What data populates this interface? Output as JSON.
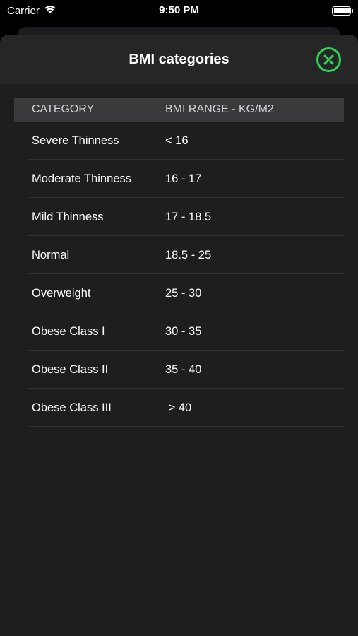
{
  "status_bar": {
    "carrier": "Carrier",
    "time": "9:50 PM",
    "icons": [
      "wifi-icon",
      "battery-icon"
    ]
  },
  "sheet": {
    "title": "BMI categories",
    "close_icon": "close-circle-icon",
    "accent_color": "#30d158"
  },
  "table": {
    "headers": [
      "CATEGORY",
      "BMI RANGE - KG/M2"
    ],
    "rows": [
      {
        "category": "Severe Thinness",
        "range": "< 16"
      },
      {
        "category": "Moderate Thinness",
        "range": "16 - 17"
      },
      {
        "category": "Mild Thinness",
        "range": "17 - 18.5"
      },
      {
        "category": "Normal",
        "range": "18.5 - 25"
      },
      {
        "category": "Overweight",
        "range": "25 - 30"
      },
      {
        "category": "Obese Class I",
        "range": "30 - 35"
      },
      {
        "category": "Obese Class II",
        "range": "35 - 40"
      },
      {
        "category": "Obese Class III",
        "range": " > 40"
      }
    ]
  }
}
